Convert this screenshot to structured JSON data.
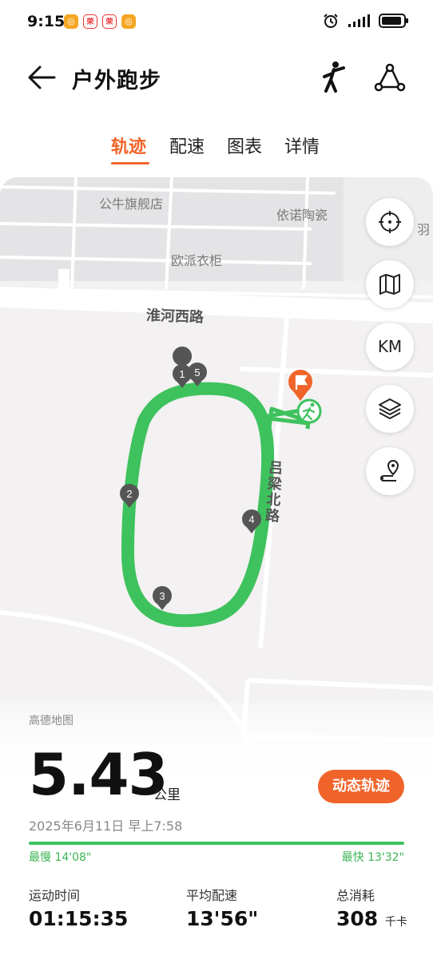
{
  "status_bar": {
    "time": "9:15",
    "apps": [
      "◎",
      "荣",
      "荣",
      "◎"
    ]
  },
  "header": {
    "title": "户外跑步"
  },
  "tabs": [
    {
      "label": "轨迹",
      "active": true
    },
    {
      "label": "配速",
      "active": false
    },
    {
      "label": "图表",
      "active": false
    },
    {
      "label": "详情",
      "active": false
    }
  ],
  "map": {
    "labels": [
      "公牛旗舰店",
      "依诺陶瓷",
      "欧派衣柜",
      "羽"
    ],
    "roads": [
      "淮河西路",
      "吕梁北路"
    ],
    "km_button_label": "KM",
    "markers": [
      "1",
      "2",
      "3",
      "4",
      "5"
    ],
    "route_color": "#3ec25e",
    "accent_color": "#f0642a"
  },
  "summary": {
    "map_provider": "高德地图",
    "distance": "5.43",
    "distance_unit": "公里",
    "dynamic_track_button": "动态轨迹",
    "date": "2025年6月11日 早上7:58",
    "slowest": "最慢 14'08\"",
    "fastest": "最快 13'32\"",
    "stats": [
      {
        "label": "运动时间",
        "value": "01:15:35",
        "unit": ""
      },
      {
        "label": "平均配速",
        "value": "13'56\"",
        "unit": ""
      },
      {
        "label": "总消耗",
        "value": "308",
        "unit": "千卡"
      }
    ]
  }
}
